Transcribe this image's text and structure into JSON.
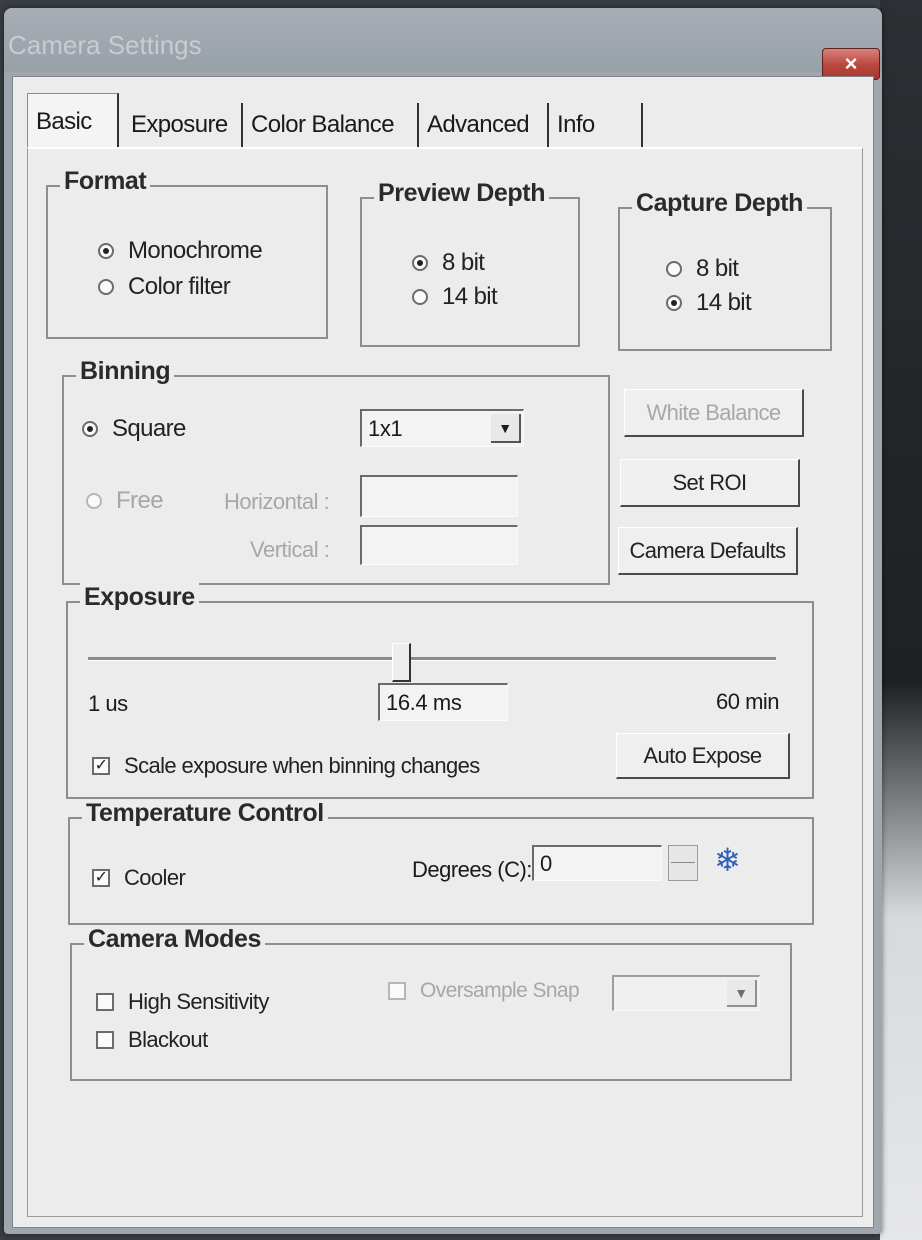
{
  "window": {
    "title": "Camera Settings",
    "close_label": "×"
  },
  "tabs": [
    {
      "label": "Basic",
      "active": true
    },
    {
      "label": "Exposure"
    },
    {
      "label": "Color Balance"
    },
    {
      "label": "Advanced"
    },
    {
      "label": "Info"
    }
  ],
  "format": {
    "title": "Format",
    "options": [
      {
        "label": "Monochrome",
        "selected": true
      },
      {
        "label": "Color filter",
        "selected": false
      }
    ]
  },
  "preview_depth": {
    "title": "Preview Depth",
    "options": [
      {
        "label": "8 bit",
        "selected": true
      },
      {
        "label": "14 bit",
        "selected": false
      }
    ]
  },
  "capture_depth": {
    "title": "Capture Depth",
    "options": [
      {
        "label": "8 bit",
        "selected": false
      },
      {
        "label": "14 bit",
        "selected": true
      }
    ]
  },
  "binning": {
    "title": "Binning",
    "square_label": "Square",
    "square_value": "1x1",
    "free_label": "Free",
    "horizontal_label": "Horizontal :",
    "vertical_label": "Vertical :",
    "horizontal_value": "",
    "vertical_value": ""
  },
  "buttons": {
    "white_balance": "White Balance",
    "set_roi": "Set ROI",
    "camera_defaults": "Camera Defaults",
    "auto_expose": "Auto Expose"
  },
  "exposure": {
    "title": "Exposure",
    "min_label": "1 us",
    "value": "16.4 ms",
    "max_label": "60 min",
    "scale_checkbox_label": "Scale exposure when binning changes",
    "scale_checked": true
  },
  "temperature": {
    "title": "Temperature Control",
    "cooler_label": "Cooler",
    "cooler_checked": true,
    "degrees_label": "Degrees (C):",
    "degrees_value": "0",
    "snowflake_icon": "❄"
  },
  "camera_modes": {
    "title": "Camera Modes",
    "high_sensitivity_label": "High Sensitivity",
    "blackout_label": "Blackout",
    "oversample_label": "Oversample Snap",
    "oversample_value": ""
  }
}
